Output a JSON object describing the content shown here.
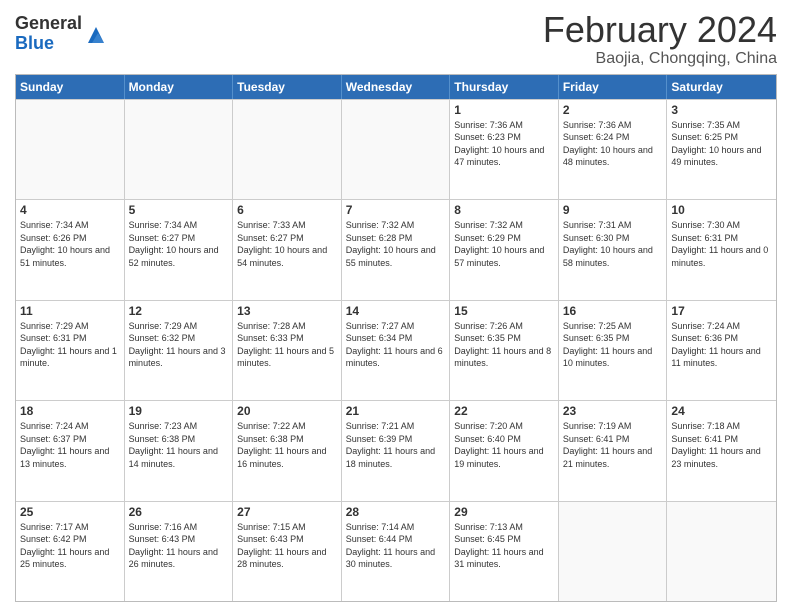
{
  "header": {
    "logo": {
      "general": "General",
      "blue": "Blue"
    },
    "month_year": "February 2024",
    "location": "Baojia, Chongqing, China"
  },
  "calendar": {
    "days_of_week": [
      "Sunday",
      "Monday",
      "Tuesday",
      "Wednesday",
      "Thursday",
      "Friday",
      "Saturday"
    ],
    "accent_color": "#2d6db5",
    "weeks": [
      [
        {
          "day": "",
          "sunrise": "",
          "sunset": "",
          "daylight": "",
          "empty": true
        },
        {
          "day": "",
          "sunrise": "",
          "sunset": "",
          "daylight": "",
          "empty": true
        },
        {
          "day": "",
          "sunrise": "",
          "sunset": "",
          "daylight": "",
          "empty": true
        },
        {
          "day": "",
          "sunrise": "",
          "sunset": "",
          "daylight": "",
          "empty": true
        },
        {
          "day": "1",
          "sunrise": "Sunrise: 7:36 AM",
          "sunset": "Sunset: 6:23 PM",
          "daylight": "Daylight: 10 hours and 47 minutes.",
          "empty": false
        },
        {
          "day": "2",
          "sunrise": "Sunrise: 7:36 AM",
          "sunset": "Sunset: 6:24 PM",
          "daylight": "Daylight: 10 hours and 48 minutes.",
          "empty": false
        },
        {
          "day": "3",
          "sunrise": "Sunrise: 7:35 AM",
          "sunset": "Sunset: 6:25 PM",
          "daylight": "Daylight: 10 hours and 49 minutes.",
          "empty": false
        }
      ],
      [
        {
          "day": "4",
          "sunrise": "Sunrise: 7:34 AM",
          "sunset": "Sunset: 6:26 PM",
          "daylight": "Daylight: 10 hours and 51 minutes.",
          "empty": false
        },
        {
          "day": "5",
          "sunrise": "Sunrise: 7:34 AM",
          "sunset": "Sunset: 6:27 PM",
          "daylight": "Daylight: 10 hours and 52 minutes.",
          "empty": false
        },
        {
          "day": "6",
          "sunrise": "Sunrise: 7:33 AM",
          "sunset": "Sunset: 6:27 PM",
          "daylight": "Daylight: 10 hours and 54 minutes.",
          "empty": false
        },
        {
          "day": "7",
          "sunrise": "Sunrise: 7:32 AM",
          "sunset": "Sunset: 6:28 PM",
          "daylight": "Daylight: 10 hours and 55 minutes.",
          "empty": false
        },
        {
          "day": "8",
          "sunrise": "Sunrise: 7:32 AM",
          "sunset": "Sunset: 6:29 PM",
          "daylight": "Daylight: 10 hours and 57 minutes.",
          "empty": false
        },
        {
          "day": "9",
          "sunrise": "Sunrise: 7:31 AM",
          "sunset": "Sunset: 6:30 PM",
          "daylight": "Daylight: 10 hours and 58 minutes.",
          "empty": false
        },
        {
          "day": "10",
          "sunrise": "Sunrise: 7:30 AM",
          "sunset": "Sunset: 6:31 PM",
          "daylight": "Daylight: 11 hours and 0 minutes.",
          "empty": false
        }
      ],
      [
        {
          "day": "11",
          "sunrise": "Sunrise: 7:29 AM",
          "sunset": "Sunset: 6:31 PM",
          "daylight": "Daylight: 11 hours and 1 minute.",
          "empty": false
        },
        {
          "day": "12",
          "sunrise": "Sunrise: 7:29 AM",
          "sunset": "Sunset: 6:32 PM",
          "daylight": "Daylight: 11 hours and 3 minutes.",
          "empty": false
        },
        {
          "day": "13",
          "sunrise": "Sunrise: 7:28 AM",
          "sunset": "Sunset: 6:33 PM",
          "daylight": "Daylight: 11 hours and 5 minutes.",
          "empty": false
        },
        {
          "day": "14",
          "sunrise": "Sunrise: 7:27 AM",
          "sunset": "Sunset: 6:34 PM",
          "daylight": "Daylight: 11 hours and 6 minutes.",
          "empty": false
        },
        {
          "day": "15",
          "sunrise": "Sunrise: 7:26 AM",
          "sunset": "Sunset: 6:35 PM",
          "daylight": "Daylight: 11 hours and 8 minutes.",
          "empty": false
        },
        {
          "day": "16",
          "sunrise": "Sunrise: 7:25 AM",
          "sunset": "Sunset: 6:35 PM",
          "daylight": "Daylight: 11 hours and 10 minutes.",
          "empty": false
        },
        {
          "day": "17",
          "sunrise": "Sunrise: 7:24 AM",
          "sunset": "Sunset: 6:36 PM",
          "daylight": "Daylight: 11 hours and 11 minutes.",
          "empty": false
        }
      ],
      [
        {
          "day": "18",
          "sunrise": "Sunrise: 7:24 AM",
          "sunset": "Sunset: 6:37 PM",
          "daylight": "Daylight: 11 hours and 13 minutes.",
          "empty": false
        },
        {
          "day": "19",
          "sunrise": "Sunrise: 7:23 AM",
          "sunset": "Sunset: 6:38 PM",
          "daylight": "Daylight: 11 hours and 14 minutes.",
          "empty": false
        },
        {
          "day": "20",
          "sunrise": "Sunrise: 7:22 AM",
          "sunset": "Sunset: 6:38 PM",
          "daylight": "Daylight: 11 hours and 16 minutes.",
          "empty": false
        },
        {
          "day": "21",
          "sunrise": "Sunrise: 7:21 AM",
          "sunset": "Sunset: 6:39 PM",
          "daylight": "Daylight: 11 hours and 18 minutes.",
          "empty": false
        },
        {
          "day": "22",
          "sunrise": "Sunrise: 7:20 AM",
          "sunset": "Sunset: 6:40 PM",
          "daylight": "Daylight: 11 hours and 19 minutes.",
          "empty": false
        },
        {
          "day": "23",
          "sunrise": "Sunrise: 7:19 AM",
          "sunset": "Sunset: 6:41 PM",
          "daylight": "Daylight: 11 hours and 21 minutes.",
          "empty": false
        },
        {
          "day": "24",
          "sunrise": "Sunrise: 7:18 AM",
          "sunset": "Sunset: 6:41 PM",
          "daylight": "Daylight: 11 hours and 23 minutes.",
          "empty": false
        }
      ],
      [
        {
          "day": "25",
          "sunrise": "Sunrise: 7:17 AM",
          "sunset": "Sunset: 6:42 PM",
          "daylight": "Daylight: 11 hours and 25 minutes.",
          "empty": false
        },
        {
          "day": "26",
          "sunrise": "Sunrise: 7:16 AM",
          "sunset": "Sunset: 6:43 PM",
          "daylight": "Daylight: 11 hours and 26 minutes.",
          "empty": false
        },
        {
          "day": "27",
          "sunrise": "Sunrise: 7:15 AM",
          "sunset": "Sunset: 6:43 PM",
          "daylight": "Daylight: 11 hours and 28 minutes.",
          "empty": false
        },
        {
          "day": "28",
          "sunrise": "Sunrise: 7:14 AM",
          "sunset": "Sunset: 6:44 PM",
          "daylight": "Daylight: 11 hours and 30 minutes.",
          "empty": false
        },
        {
          "day": "29",
          "sunrise": "Sunrise: 7:13 AM",
          "sunset": "Sunset: 6:45 PM",
          "daylight": "Daylight: 11 hours and 31 minutes.",
          "empty": false
        },
        {
          "day": "",
          "sunrise": "",
          "sunset": "",
          "daylight": "",
          "empty": true
        },
        {
          "day": "",
          "sunrise": "",
          "sunset": "",
          "daylight": "",
          "empty": true
        }
      ]
    ]
  }
}
